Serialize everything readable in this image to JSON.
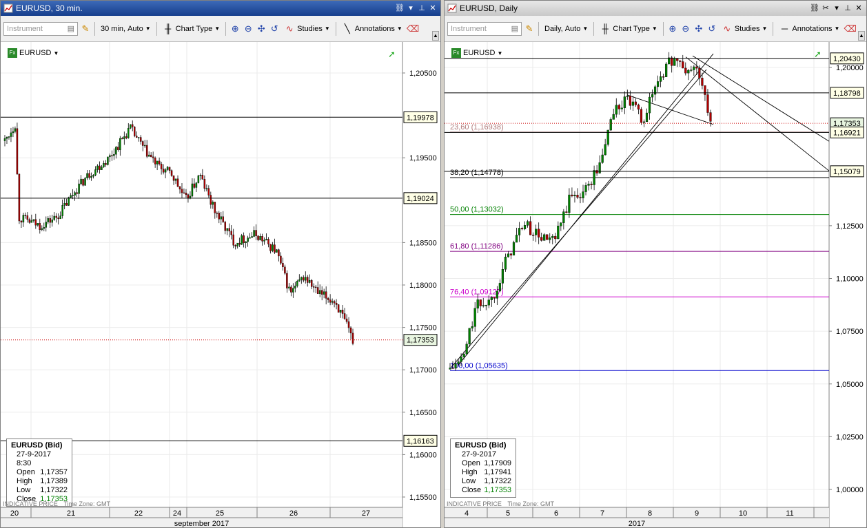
{
  "panels": [
    {
      "title": "EURUSD, 30 min.",
      "toolbar": {
        "instrument_placeholder": "Instrument",
        "timeframe": "30 min,",
        "scale": "Auto",
        "chart_type": "Chart Type",
        "studies": "Studies",
        "annotations": "Annotations"
      },
      "symbol": "EURUSD",
      "price_axis": [
        "1,20500",
        "1,19500",
        "1,18500",
        "1,18000",
        "1,17500",
        "1,17000",
        "1,16500",
        "1,16000",
        "1,15500"
      ],
      "price_tags": [
        {
          "value": "1,19978",
          "kind": "line"
        },
        {
          "value": "1,19024",
          "kind": "line"
        },
        {
          "value": "1,17353",
          "kind": "current"
        },
        {
          "value": "1,16163",
          "kind": "line"
        }
      ],
      "time_labels": [
        "20",
        "21",
        "22",
        "24",
        "25",
        "26",
        "27"
      ],
      "period_label": "september 2017",
      "indicative": "INDICATIVE PRICE",
      "timezone": "Time Zone: GMT",
      "info": {
        "title": "EURUSD (Bid)",
        "datetime": "27-9-2017 8:30",
        "open_label": "Open",
        "open": "1,17357",
        "high_label": "High",
        "high": "1,17389",
        "low_label": "Low",
        "low": "1,17322",
        "close_label": "Close",
        "close": "1,17353"
      }
    },
    {
      "title": "EURUSD, Daily",
      "toolbar": {
        "instrument_placeholder": "Instrument",
        "timeframe": "Daily,",
        "scale": "Auto",
        "chart_type": "Chart Type",
        "studies": "Studies",
        "annotations": "Annotations"
      },
      "symbol": "EURUSD",
      "price_axis": [
        "1,20000",
        "1,12500",
        "1,10000",
        "1,07500",
        "1,05000",
        "1,02500",
        "1,00000"
      ],
      "price_tags": [
        {
          "value": "1,20430",
          "kind": "line"
        },
        {
          "value": "1,18798",
          "kind": "line"
        },
        {
          "value": "1,17353",
          "kind": "current"
        },
        {
          "value": "1,16921",
          "kind": "line"
        },
        {
          "value": "1,15079",
          "kind": "line"
        }
      ],
      "fib_levels": [
        {
          "label": "23,60 (1,16938)",
          "color": "#b07a7a"
        },
        {
          "label": "38,20 (1,14778)",
          "color": "#000000"
        },
        {
          "label": "50,00 (1,13032)",
          "color": "#008000"
        },
        {
          "label": "61,80 (1,11286)",
          "color": "#800080"
        },
        {
          "label": "76,40 (1,09127)",
          "color": "#cc00cc"
        },
        {
          "label": "100,00 (1,05635)",
          "color": "#0000cc"
        }
      ],
      "time_labels": [
        "4",
        "5",
        "6",
        "7",
        "8",
        "9",
        "10",
        "11"
      ],
      "period_label": "2017",
      "indicative": "INDICATIVE PRICE",
      "timezone": "Time Zone: GMT",
      "info": {
        "title": "EURUSD (Bid)",
        "datetime": "27-9-2017",
        "open_label": "Open",
        "open": "1,17909",
        "high_label": "High",
        "high": "1,17941",
        "low_label": "Low",
        "low": "1,17322",
        "close_label": "Close",
        "close": "1,17353"
      }
    }
  ],
  "colors": {
    "up_candle": "#008000",
    "down_candle": "#b00000",
    "current_price": "#cc0000",
    "current_tag_bg": "#e8f5e0"
  }
}
